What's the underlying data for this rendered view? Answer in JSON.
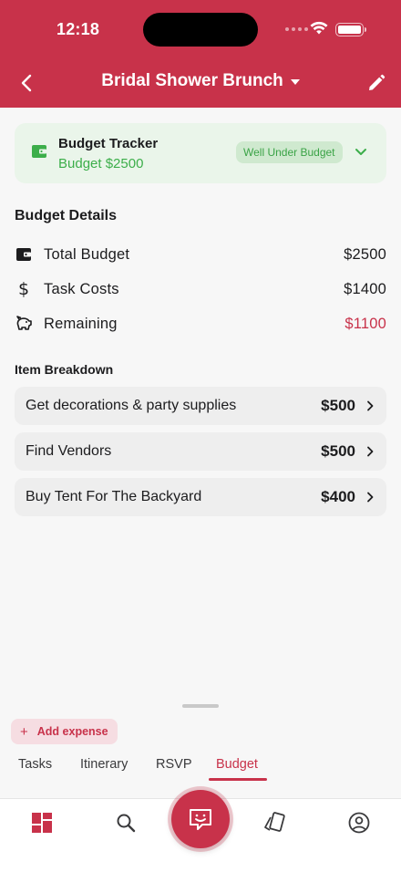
{
  "status_bar": {
    "time": "12:18"
  },
  "header": {
    "title": "Bridal Shower Brunch"
  },
  "tracker": {
    "title": "Budget Tracker",
    "subtitle": "Budget $2500",
    "badge": "Well Under Budget"
  },
  "budget_details": {
    "heading": "Budget Details",
    "rows": [
      {
        "label": "Total Budget",
        "value": "$2500",
        "icon": "wallet-icon"
      },
      {
        "label": "Task Costs",
        "value": "$1400",
        "icon": "dollar-icon"
      },
      {
        "label": "Remaining",
        "value": "$1100",
        "icon": "piggy-bank-icon"
      }
    ]
  },
  "breakdown": {
    "heading": "Item Breakdown",
    "items": [
      {
        "name": "Get decorations & party supplies",
        "price": "$500"
      },
      {
        "name": "Find Vendors",
        "price": "$500"
      },
      {
        "name": "Buy Tent For The Backyard",
        "price": "$400"
      }
    ]
  },
  "actions": {
    "add_expense": "Add expense"
  },
  "tabs": [
    {
      "label": "Tasks",
      "active": false
    },
    {
      "label": "Itinerary",
      "active": false
    },
    {
      "label": "RSVP",
      "active": false
    },
    {
      "label": "Budget",
      "active": true
    }
  ],
  "bottom_nav": [
    "dashboard-icon",
    "search-icon",
    "chat-icon",
    "cards-icon",
    "profile-icon"
  ],
  "colors": {
    "brand": "#c8324a",
    "success": "#3cae4a",
    "success_bg": "#eaf5ea"
  }
}
